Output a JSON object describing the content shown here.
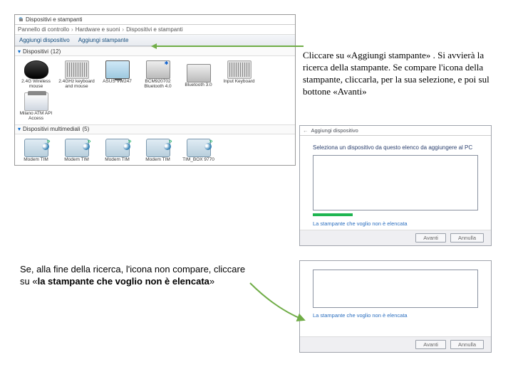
{
  "panel": {
    "title": "Dispositivi e stampanti",
    "crumbs": [
      "Pannello di controllo",
      "Hardware e suoni",
      "Dispositivi e stampanti"
    ],
    "toolbar": {
      "add_device": "Aggiungi dispositivo",
      "add_printer": "Aggiungi stampante"
    },
    "group1": {
      "label": "Dispositivi",
      "count": "(12)"
    },
    "devices": [
      {
        "name": "2.4G Wireless mouse",
        "icon": "mouse"
      },
      {
        "name": "2.4GHz keyboard and mouse",
        "icon": "kb"
      },
      {
        "name": "ASUS VW247",
        "icon": "mon"
      },
      {
        "name": "BCM920702 Bluetooth 4.0",
        "icon": "bt"
      },
      {
        "name": "Bluetooth 3.0",
        "icon": "bt2"
      },
      {
        "name": "Input Keyboard",
        "icon": "kb"
      },
      {
        "name": "Milano ATM API Access",
        "icon": "tim"
      }
    ],
    "group2": {
      "label": "Dispositivi multimediali",
      "count": "(5)"
    },
    "media": [
      {
        "name": "Modem TIM",
        "icon": "speak"
      },
      {
        "name": "Modem TIM",
        "icon": "speak"
      },
      {
        "name": "Modem TIM",
        "icon": "speak"
      },
      {
        "name": "Modem TIM",
        "icon": "speak"
      },
      {
        "name": "TIM_BOX 9770",
        "icon": "speak"
      }
    ]
  },
  "annotations": {
    "a1": "Cliccare su «Aggiungi stampante» . Si avvierà la ricerca della stampante. Se compare l'icona della stampante, cliccarla, per la sua selezione, e poi sul bottone «Avanti»",
    "a2_pre": "Se, alla fine della ricerca, l'icona non compare, cliccare su «",
    "a2_bold": "la stampante che voglio non è elencata",
    "a2_post": "»"
  },
  "dialog": {
    "title": "Aggiungi dispositivo",
    "prompt": "Seleziona un dispositivo da questo elenco da aggiungere al PC",
    "link": "La stampante che voglio non è elencata",
    "next": "Avanti",
    "cancel": "Annulla"
  }
}
